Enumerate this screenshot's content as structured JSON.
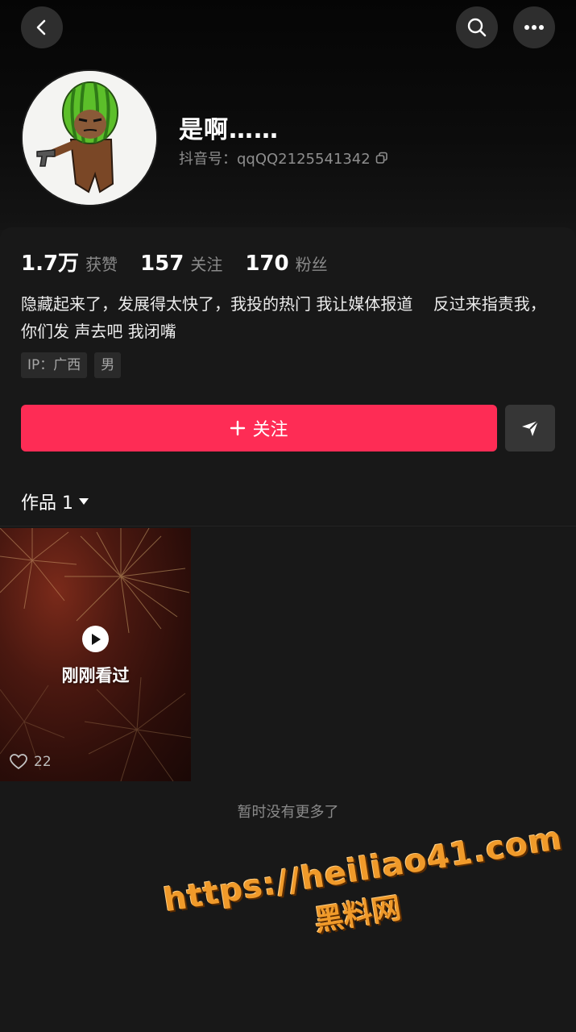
{
  "header": {
    "back_icon": "chevron-left-icon",
    "search_icon": "search-icon",
    "more_icon": "more-dots-icon"
  },
  "profile": {
    "nickname": "是啊……",
    "douyin_id": "抖音号：qqQQ2125541342",
    "copy_icon": "copy-icon"
  },
  "stats": [
    {
      "value": "1.7万",
      "label": "获赞"
    },
    {
      "value": "157",
      "label": "关注"
    },
    {
      "value": "170",
      "label": "粉丝"
    }
  ],
  "bio": "隐藏起来了，发展得太快了，我投的热门 我让媒体报道    反过来指责我，你们发 声去吧 我闭嘴",
  "tags": [
    "IP：广西",
    "男"
  ],
  "actions": {
    "follow_label": "关注",
    "follow_icon": "plus-icon",
    "share_icon": "send-icon"
  },
  "works": {
    "tab_label": "作品 1",
    "dropdown_icon": "triangle-down-icon",
    "items": [
      {
        "overlay_label": "刚刚看过",
        "likes": "22",
        "play_icon": "play-icon",
        "like_icon": "heart-icon"
      }
    ],
    "end_text": "暂时没有更多了"
  },
  "watermark": {
    "url": "https://heiliao41.com",
    "site": "黑料网"
  },
  "colors": {
    "follow_button": "#fe2c55",
    "background": "#161616",
    "watermark": "#f09a2a"
  }
}
